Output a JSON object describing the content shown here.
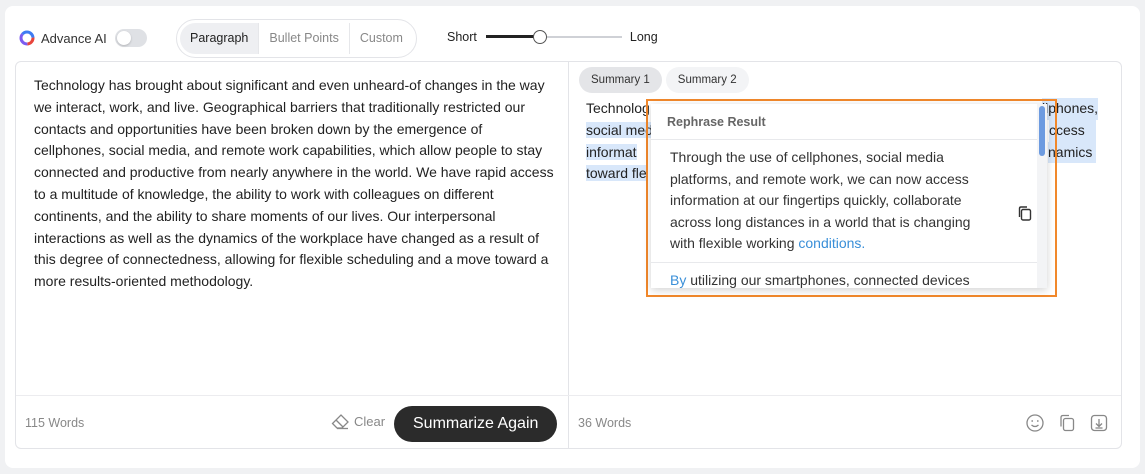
{
  "toolbar": {
    "advance_ai_label": "Advance AI",
    "advance_ai_enabled": false,
    "modes": [
      "Paragraph",
      "Bullet Points",
      "Custom"
    ],
    "active_mode": "Paragraph",
    "length_short_label": "Short",
    "length_long_label": "Long",
    "length_level": 0.4
  },
  "source": {
    "text": "Technology has brought about significant and even unheard-of changes in the way we interact, work, and live. Geographical barriers that traditionally restricted our contacts and opportunities have been broken down by the emergence of cellphones, social media, and remote work capabilities, which allow people to stay connected and productive from nearly anywhere in the world. We have rapid access to a multitude of knowledge, the ability to work with colleagues on different continents, and the ability to share moments of our lives. Our interpersonal interactions as well as the dynamics of the workplace have changed as a result of this degree of connectedness, allowing for flexible scheduling and a move toward a more results-oriented methodology.",
    "word_count": "115 Words",
    "clear_label": "Clear",
    "summarize_label": "Summarize Again"
  },
  "summary": {
    "tabs": [
      "Summary 1",
      "Summary 2"
    ],
    "active_tab": "Summary 1",
    "line1": "Technolog",
    "line1_end": "llphones,",
    "line2": "social med",
    "line2_end": "ccess to",
    "line3": "informat",
    "line3_end": "namics",
    "line4": "toward fle",
    "word_count": "36 Words"
  },
  "popup": {
    "title": "Rephrase Result",
    "option1_text": "Through the use of cellphones, social media platforms, and remote work, we can now access information at our fingertips quickly, collaborate across long distances in a world that is changing with flexible working",
    "option1_link": "conditions.",
    "option2_link": "By",
    "option2_text": " utilizing our smartphones, connected devices"
  },
  "colors": {
    "highlight": "#d8e7fa",
    "popup_outline": "#f1882b",
    "link": "#3a8fd8",
    "button_dark": "#2b2b2b"
  },
  "icons": [
    "ai-logo-icon",
    "eraser-icon",
    "emoji-icon",
    "copy-icon",
    "download-icon"
  ]
}
